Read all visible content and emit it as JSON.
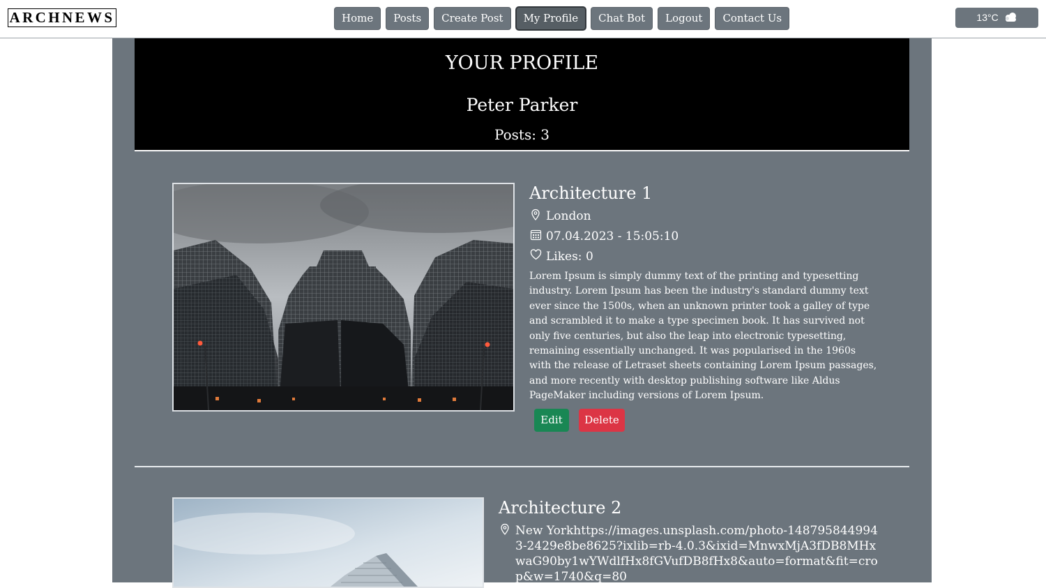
{
  "header": {
    "brand": "ARCHNEWS",
    "nav": [
      {
        "label": "Home"
      },
      {
        "label": "Posts"
      },
      {
        "label": "Create Post"
      },
      {
        "label": "My Profile",
        "active": true
      },
      {
        "label": "Chat Bot"
      },
      {
        "label": "Logout"
      },
      {
        "label": "Contact Us"
      }
    ],
    "weather": {
      "temp": "13°C",
      "icon": "cloud-icon"
    }
  },
  "profile": {
    "heading": "YOUR PROFILE",
    "name": "Peter Parker",
    "posts_count": "Posts: 3"
  },
  "posts": [
    {
      "title": "Architecture 1",
      "location": "London",
      "datetime": "07.04.2023 - 15:05:10",
      "likes": "Likes: 0",
      "description": "Lorem Ipsum is simply dummy text of the printing and typesetting industry. Lorem Ipsum has been the industry's standard dummy text ever since the 1500s, when an unknown printer took a galley of type and scrambled it to make a type specimen book. It has survived not only five centuries, but also the leap into electronic typesetting, remaining essentially unchanged. It was popularised in the 1960s with the release of Letraset sheets containing Lorem Ipsum passages, and more recently with desktop publishing software like Aldus PageMaker including versions of Lorem Ipsum.",
      "edit_label": "Edit",
      "delete_label": "Delete"
    },
    {
      "title": "Architecture 2",
      "location": "New Yorkhttps://images.unsplash.com/photo-1487958449943-2429e8be8625?ixlib=rb-4.0.3&ixid=MnwxMjA3fDB8MHxwaG90by1wYWdlfHx8fGVufDB8fHx8&auto=format&fit=crop&w=1740&q=80"
    }
  ],
  "colors": {
    "panel": "#6c757d",
    "hero": "#000000",
    "edit": "#198754",
    "delete": "#dc3545"
  }
}
